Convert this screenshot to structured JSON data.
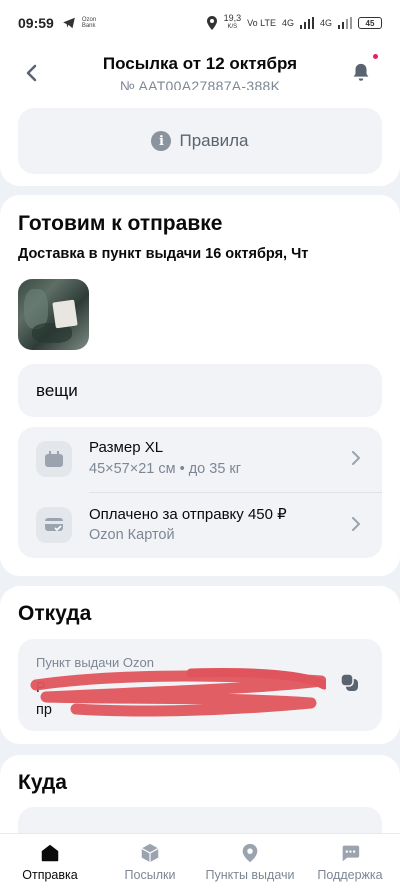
{
  "status_bar": {
    "time": "09:59",
    "tiny_text_1": "Ozon",
    "tiny_text_2": "Bank",
    "speed": "19,3",
    "speed_unit": "K/S",
    "net1": "Vo LTE",
    "net2": "4G",
    "net3": "4G",
    "battery": "45"
  },
  "header": {
    "title": "Посылка от 12 октября",
    "subtitle": "№ AAT00A27887A-388K"
  },
  "rules_button": {
    "label": "Правила",
    "icon": "info-icon"
  },
  "shipment": {
    "status_title": "Готовим к отправке",
    "delivery_text": "Доставка в пункт выдачи 16 октября, Чт",
    "items_label": "вещи",
    "size_title": "Размер XL",
    "size_details": "45×57×21 см • до 35 кг",
    "payment_title": "Оплачено за отправку 450 ₽",
    "payment_method": "Ozon Картой"
  },
  "from": {
    "title": "Откуда",
    "pickup_label": "Пункт выдачи Ozon",
    "address_line1": "Р",
    "address_line2": "пр"
  },
  "to": {
    "title": "Куда"
  },
  "tabbar": {
    "tabs": [
      {
        "label": "Отправка",
        "icon": "home-icon",
        "active": true
      },
      {
        "label": "Посылки",
        "icon": "box-icon",
        "active": false
      },
      {
        "label": "Пункты выдачи",
        "icon": "map-pin-icon",
        "active": false
      },
      {
        "label": "Поддержка",
        "icon": "chat-icon",
        "active": false
      }
    ]
  },
  "colors": {
    "background": "#eef1f6",
    "card": "#ffffff",
    "muted_text": "#7d8794",
    "notification_dot": "#e0245e",
    "redaction": "#e0555d"
  }
}
